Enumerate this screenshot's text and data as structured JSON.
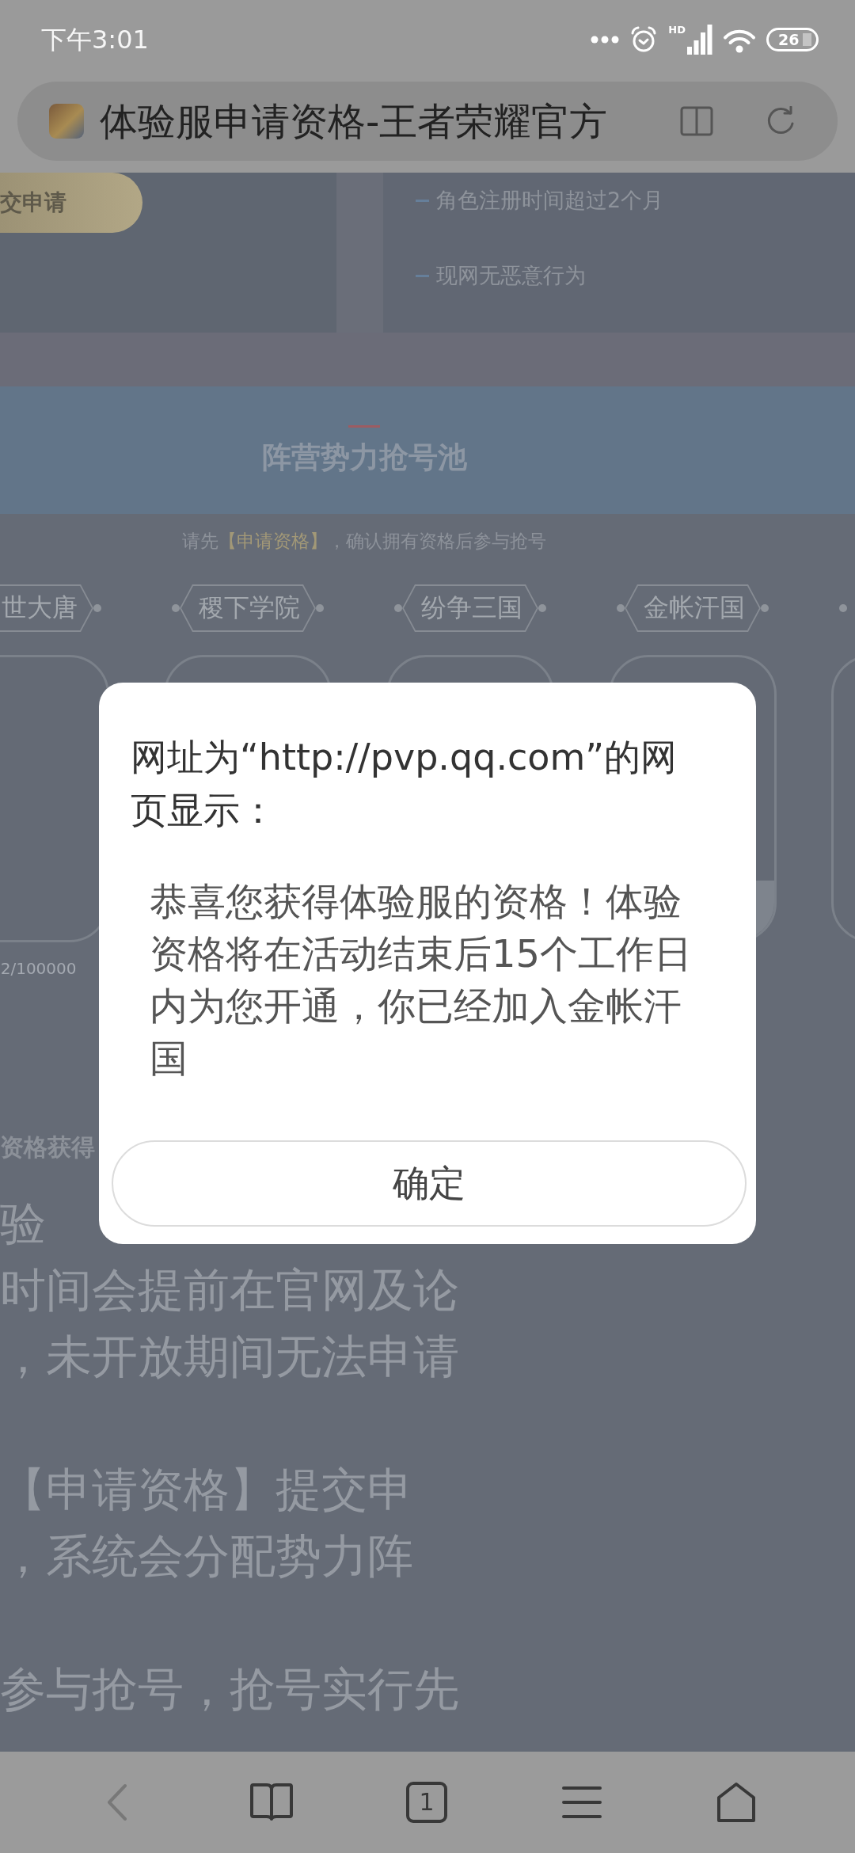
{
  "status_bar": {
    "time": "下午3:01",
    "network_label": "HD",
    "battery_text": "26"
  },
  "address_bar": {
    "page_title": "体验服申请资格-王者荣耀官方"
  },
  "page": {
    "submit_button": "交申请",
    "requirements": [
      "角色注册时间超过2个月",
      "现网无恶意行为"
    ],
    "section_title": "阵营势力抢号池",
    "notice": {
      "before": "请先",
      "link": "【申请资格】",
      "after": "，确认拥有资格后参与抢号"
    },
    "factions": [
      {
        "label": "世大唐",
        "count": "2/100000"
      },
      {
        "label": "稷下学院"
      },
      {
        "label": "纷争三国"
      },
      {
        "label": "金帐汗国",
        "level": 0.21
      }
    ],
    "rules_heading": "资格获得",
    "rules_paragraphs": [
      [
        "验",
        "时间会提前在官网及论",
        "，未开放期间无法申请"
      ],
      [
        "【申请资格】提交申",
        "，系统会分配势力阵"
      ],
      [
        "参与抢号，抢号实行先"
      ]
    ]
  },
  "dialog": {
    "title": "网址为“http://pvp.qq.com”的网页显示：",
    "message": "恭喜您获得体验服的资格！体验资格将在活动结束后15个工作日内为您开通，你已经加入金帐汗国",
    "button": "确定"
  },
  "bottom_nav": [
    {
      "kind": "back",
      "disabled": true
    },
    {
      "kind": "bookmarks",
      "disabled": false
    },
    {
      "kind": "tabs",
      "count": "1",
      "disabled": false
    },
    {
      "kind": "menu",
      "disabled": false
    },
    {
      "kind": "home",
      "disabled": false
    }
  ]
}
